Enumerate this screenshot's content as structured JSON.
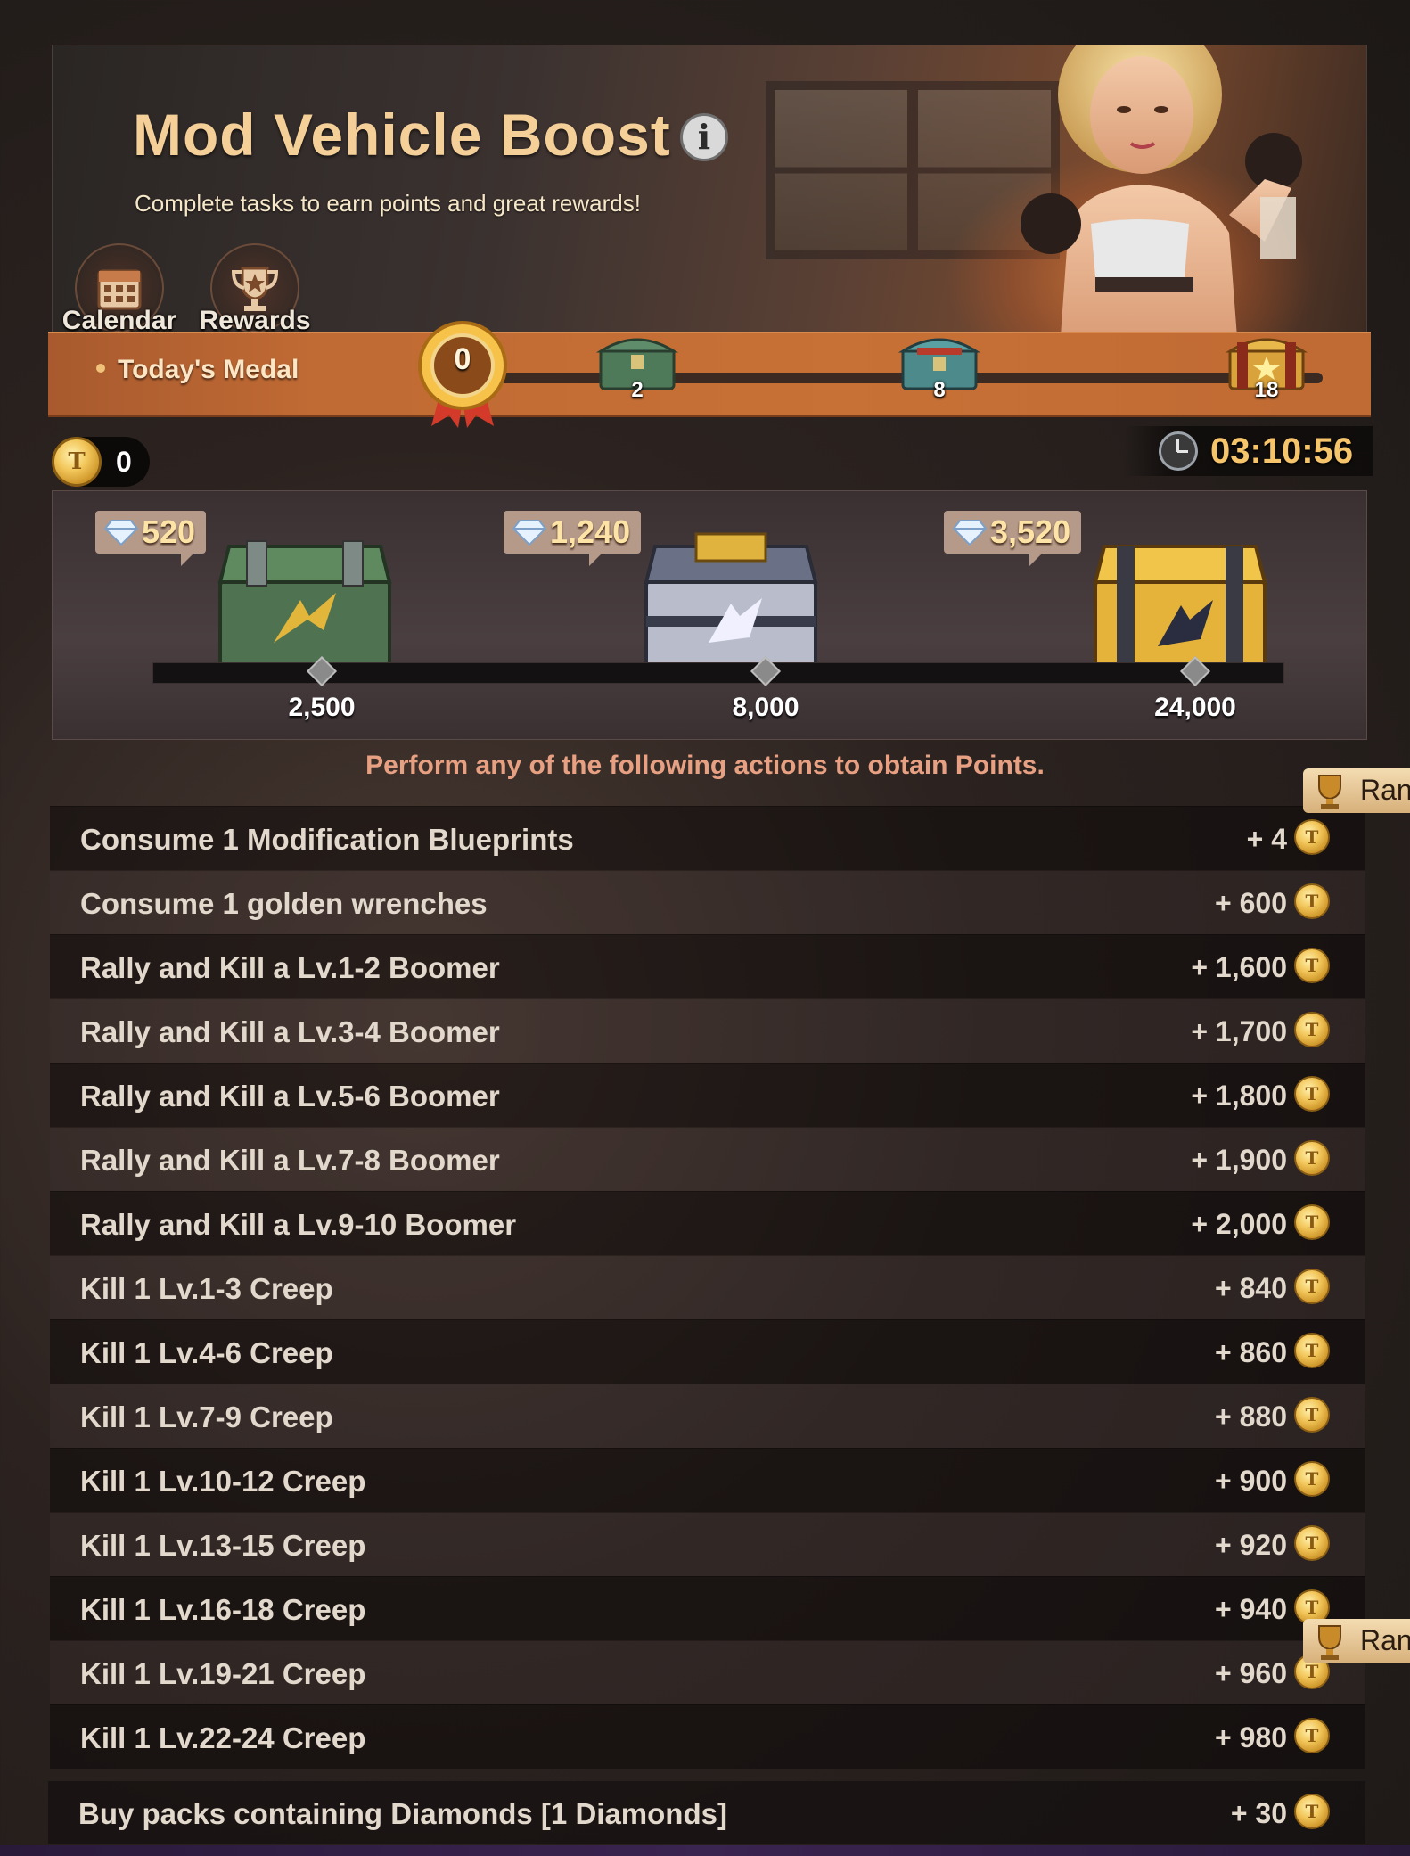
{
  "header": {
    "title": "Mod Vehicle Boost",
    "subtitle": "Complete tasks to earn points and great rewards!",
    "buttons": [
      {
        "label": "Calendar",
        "icon": "calendar-icon"
      },
      {
        "label": "Rewards",
        "icon": "trophy-icon"
      }
    ]
  },
  "medal_bar": {
    "label": "Today's Medal",
    "current": "0",
    "milestones": [
      "2",
      "8",
      "18"
    ]
  },
  "points": {
    "value": "0"
  },
  "timer": {
    "value": "03:10:56"
  },
  "reward_tiers": [
    {
      "diamonds": "520",
      "threshold": "2,500",
      "chest": "green"
    },
    {
      "diamonds": "1,240",
      "threshold": "8,000",
      "chest": "silver"
    },
    {
      "diamonds": "3,520",
      "threshold": "24,000",
      "chest": "gold"
    }
  ],
  "instructions": "Perform any of the following actions to obtain Points.",
  "rank_tab": {
    "label": "Ran"
  },
  "tasks": [
    {
      "name": "Consume 1 Modification Blueprints",
      "points": "+ 4"
    },
    {
      "name": "Consume 1 golden wrenches",
      "points": "+ 600"
    },
    {
      "name": "Rally and Kill a Lv.1-2 Boomer",
      "points": "+ 1,600"
    },
    {
      "name": "Rally and Kill a Lv.3-4 Boomer",
      "points": "+ 1,700"
    },
    {
      "name": "Rally and Kill a Lv.5-6 Boomer",
      "points": "+ 1,800"
    },
    {
      "name": "Rally and Kill a Lv.7-8 Boomer",
      "points": "+ 1,900"
    },
    {
      "name": "Rally and Kill a Lv.9-10 Boomer",
      "points": "+ 2,000"
    },
    {
      "name": "Kill 1 Lv.1-3 Creep",
      "points": "+ 840"
    },
    {
      "name": "Kill 1 Lv.4-6 Creep",
      "points": "+ 860"
    },
    {
      "name": "Kill 1 Lv.7-9 Creep",
      "points": "+ 880"
    },
    {
      "name": "Kill 1 Lv.10-12 Creep",
      "points": "+ 900"
    },
    {
      "name": "Kill 1 Lv.13-15 Creep",
      "points": "+ 920"
    },
    {
      "name": "Kill 1 Lv.16-18 Creep",
      "points": "+ 940"
    },
    {
      "name": "Kill 1 Lv.19-21 Creep",
      "points": "+ 960"
    },
    {
      "name": "Kill 1 Lv.22-24 Creep",
      "points": "+ 980"
    }
  ],
  "last_task": {
    "name": "Buy packs containing Diamonds [1 Diamonds]",
    "points": "+ 30"
  },
  "colors": {
    "title": "#f5cf98",
    "timer": "#f6c46a",
    "medal_bar": "#c06a34",
    "instructions": "#e8a082"
  }
}
